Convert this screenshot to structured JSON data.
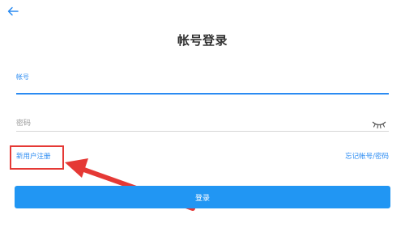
{
  "header": {
    "title": "帐号登录",
    "back_icon": "arrow-left-icon"
  },
  "form": {
    "account_label": "帐号",
    "account_value": "",
    "password_placeholder": "密码",
    "password_toggle_icon": "eye-closed-icon"
  },
  "links": {
    "register": "新用户注册",
    "forgot": "忘记帐号/密码"
  },
  "actions": {
    "login": "登录"
  },
  "colors": {
    "accent": "#2b8bf2",
    "button": "#2196f3",
    "annotation": "#e53935"
  }
}
